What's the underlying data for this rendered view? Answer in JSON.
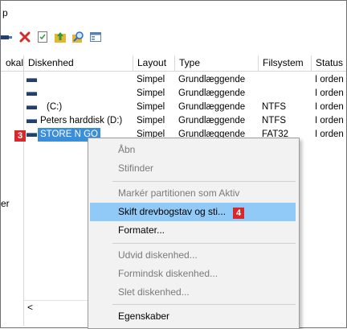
{
  "menu_fragment": "p",
  "toolbar": {
    "icons": [
      "connect-icon",
      "delete-icon",
      "properties-icon",
      "help-icon",
      "rescan-icon",
      "view-icon"
    ],
    "colors": {
      "delete": "#d62b2b",
      "folder": "#e6a500",
      "blue": "#2a6bd1"
    }
  },
  "left_panel": {
    "header": "okal",
    "text": "er"
  },
  "table": {
    "columns": [
      "Diskenhed",
      "Layout",
      "Type",
      "Filsystem",
      "Status"
    ],
    "rows": [
      {
        "name": "",
        "layout": "Simpel",
        "type": "Grundlæggende",
        "fs": "",
        "status": "I orden"
      },
      {
        "name": "",
        "layout": "Simpel",
        "type": "Grundlæggende",
        "fs": "",
        "status": "I orden"
      },
      {
        "name": "(C:)",
        "layout": "Simpel",
        "type": "Grundlæggende",
        "fs": "NTFS",
        "status": "I orden"
      },
      {
        "name": "Peters harddisk (D:)",
        "layout": "Simpel",
        "type": "Grundlæggende",
        "fs": "NTFS",
        "status": "I orden"
      },
      {
        "name": "STORE N GO",
        "layout": "Simpel",
        "type": "Grundlæggende",
        "fs": "FAT32",
        "status": "I orden"
      }
    ]
  },
  "badges": {
    "step3": "3",
    "step4": "4",
    "color": "#d7282b"
  },
  "context_menu": {
    "items": [
      {
        "label": "Åbn",
        "disabled": true
      },
      {
        "label": "Stifinder",
        "disabled": true
      },
      {
        "label": "Markér partitionen som Aktiv",
        "disabled": true
      },
      {
        "label": "Skift drevbogstav og sti...",
        "disabled": false,
        "highlighted": true
      },
      {
        "label": "Formater...",
        "disabled": false
      },
      {
        "label": "Udvid diskenhed...",
        "disabled": true
      },
      {
        "label": "Formindsk diskenhed...",
        "disabled": true
      },
      {
        "label": "Slet diskenhed...",
        "disabled": true
      },
      {
        "label": "Egenskaber",
        "disabled": false
      }
    ]
  },
  "scroll_left_glyph": "<"
}
